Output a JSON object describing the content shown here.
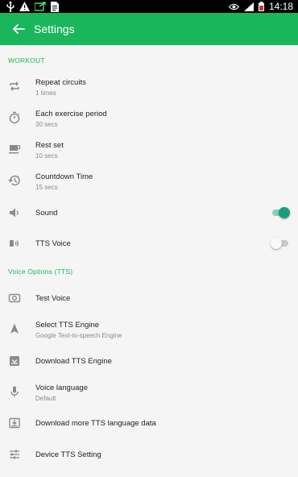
{
  "status_bar": {
    "time": "14:18"
  },
  "app_bar": {
    "title": "Settings"
  },
  "sections": {
    "workout": "WORKOUT",
    "voice_options": "Voice Options (TTS)"
  },
  "workout": {
    "repeat_circuits": {
      "title": "Repeat circuits",
      "value": "1 times"
    },
    "each_exercise_period": {
      "title": "Each exercise period",
      "value": "30 secs"
    },
    "rest_set": {
      "title": "Rest set",
      "value": "10 secs"
    },
    "countdown_time": {
      "title": "Countdown Time",
      "value": "15 secs"
    },
    "sound": {
      "title": "Sound",
      "enabled": true
    },
    "tts_voice": {
      "title": "TTS Voice",
      "enabled": false
    }
  },
  "voice_options": {
    "test_voice": {
      "title": "Test Voice"
    },
    "select_tts_engine": {
      "title": "Select TTS Engine",
      "value": "Google Text-to-speech Engine"
    },
    "download_tts_engine": {
      "title": "Download TTS Engine"
    },
    "voice_language": {
      "title": "Voice language",
      "value": "Default"
    },
    "download_more_tts_language_data": {
      "title": "Download more TTS language data"
    },
    "device_tts_setting": {
      "title": "Device TTS Setting"
    }
  },
  "colors": {
    "accent": "#1ab65c",
    "toggle_on": "#1a9d7b",
    "icon_gray": "#8a8a8a"
  }
}
